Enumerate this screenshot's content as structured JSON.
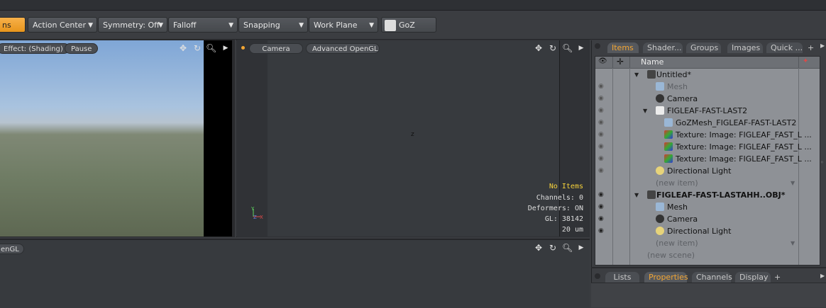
{
  "toolbar": {
    "first_partial": "ns",
    "items": [
      {
        "label": "Action Center"
      },
      {
        "label": "Symmetry: Off"
      },
      {
        "label": "Falloff"
      },
      {
        "label": "Snapping"
      },
      {
        "label": "Work Plane"
      },
      {
        "label": "GoZ"
      }
    ]
  },
  "viewport_left": {
    "effect_label": "Effect: (Shading)",
    "pause_label": "Pause"
  },
  "viewport_camera": {
    "camera_label": "Camera",
    "gl_label": "Advanced OpenGL",
    "axis_hint": "z",
    "info": {
      "no_items": "No Items",
      "channels": "Channels: 0",
      "deformers": "Deformers: ON",
      "gl": "GL: 38142",
      "units": "20 um"
    },
    "axis_gizmo": {
      "x": "X",
      "y": "Y",
      "z": "Z"
    }
  },
  "viewport_bottom": {
    "gl_partial": "enGL"
  },
  "items_panel": {
    "tabs": [
      "Items",
      "Shader...",
      "Groups",
      "Images",
      "Quick ...",
      "+"
    ],
    "active_tab": "Items",
    "column_name": "Name",
    "rows": [
      {
        "label": "Untitled*"
      },
      {
        "label": "Mesh"
      },
      {
        "label": "Camera"
      },
      {
        "label": "FIGLEAF-FAST-LAST2"
      },
      {
        "label": "GoZMesh_FIGLEAF-FAST-LAST2"
      },
      {
        "label": "Texture: Image: FIGLEAF_FAST_L ..."
      },
      {
        "label": "Texture: Image: FIGLEAF_FAST_L ..."
      },
      {
        "label": "Texture: Image: FIGLEAF_FAST_L ..."
      },
      {
        "label": "Directional Light"
      },
      {
        "label": "(new item)"
      },
      {
        "label": "FIGLEAF-FAST-LASTAHH..OBJ*"
      },
      {
        "label": "Mesh"
      },
      {
        "label": "Camera"
      },
      {
        "label": "Directional Light"
      },
      {
        "label": "(new item)"
      },
      {
        "label": "(new scene)"
      }
    ]
  },
  "properties_panel": {
    "tabs": [
      "Lists",
      "Properties",
      "Channels",
      "Display",
      "+"
    ],
    "active_tab": "Properties"
  },
  "colors": {
    "accent": "#f3a634",
    "toolbar_active": "#e8951c"
  }
}
